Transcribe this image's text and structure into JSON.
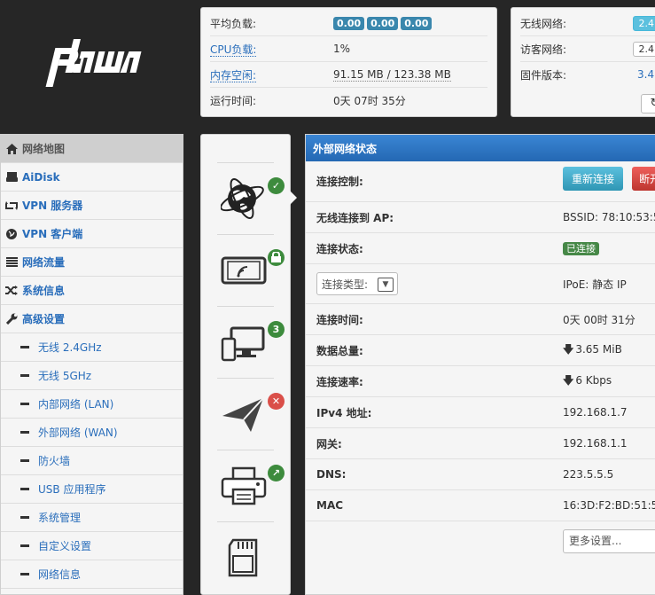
{
  "stats": {
    "load_label": "平均负载:",
    "load_values": [
      "0.00",
      "0.00",
      "0.00"
    ],
    "cpu_label": "CPU负载:",
    "cpu_value": "1%",
    "mem_label": "内存空闲:",
    "mem_value": "91.15 MB / 123.38 MB",
    "uptime_label": "运行时间:",
    "uptime_value": "0天 07时 35分"
  },
  "net": {
    "wifi_label": "无线网络:",
    "wifi_value": "2.4",
    "guest_label": "访客网络:",
    "guest_value": "2.4",
    "fw_label": "固件版本:",
    "fw_value": "3.4."
  },
  "menu": {
    "items": [
      {
        "label": "网络地图",
        "icon": "home-icon"
      },
      {
        "label": "AiDisk",
        "icon": "hdd-icon"
      },
      {
        "label": "VPN 服务器",
        "icon": "retweet-icon"
      },
      {
        "label": "VPN 客户端",
        "icon": "globe-icon"
      },
      {
        "label": "网络流量",
        "icon": "list-icon"
      },
      {
        "label": "系统信息",
        "icon": "random-icon"
      },
      {
        "label": "高级设置",
        "icon": "wrench-icon"
      }
    ],
    "subs": [
      "无线 2.4GHz",
      "无线 5GHz",
      "内部网络 (LAN)",
      "外部网络 (WAN)",
      "防火墙",
      "USB 应用程序",
      "系统管理",
      "自定义设置",
      "网络信息"
    ]
  },
  "icon_badges": {
    "clients_count": "3"
  },
  "wan": {
    "title": "外部网络状态",
    "control_label": "连接控制:",
    "reconnect": "重新连接",
    "disconnect": "断开",
    "ap_label": "无线连接到 AP:",
    "ap_value": "BSSID: 78:10:53:5",
    "state_label": "连接状态:",
    "state_value": "已连接",
    "type_select": "连接类型:",
    "type_value": "IPoE: 静态 IP",
    "time_label": "连接时间:",
    "time_value": "0天 00时 31分",
    "data_label": "数据总量:",
    "data_value": "3.65 MiB",
    "speed_label": "连接速率:",
    "speed_value": "6 Kbps",
    "ipv4_label": "IPv4 地址:",
    "ipv4_value": "192.168.1.7",
    "gw_label": "网关:",
    "gw_value": "192.168.1.1",
    "dns_label": "DNS:",
    "dns_value": "223.5.5.5",
    "mac_label": "MAC",
    "mac_value": "16:3D:F2:BD:51:5",
    "more": "更多设置..."
  },
  "colors": {
    "accent": "#2e79c5",
    "link": "#2a6ebb",
    "success": "#468847",
    "danger": "#da4f49"
  }
}
